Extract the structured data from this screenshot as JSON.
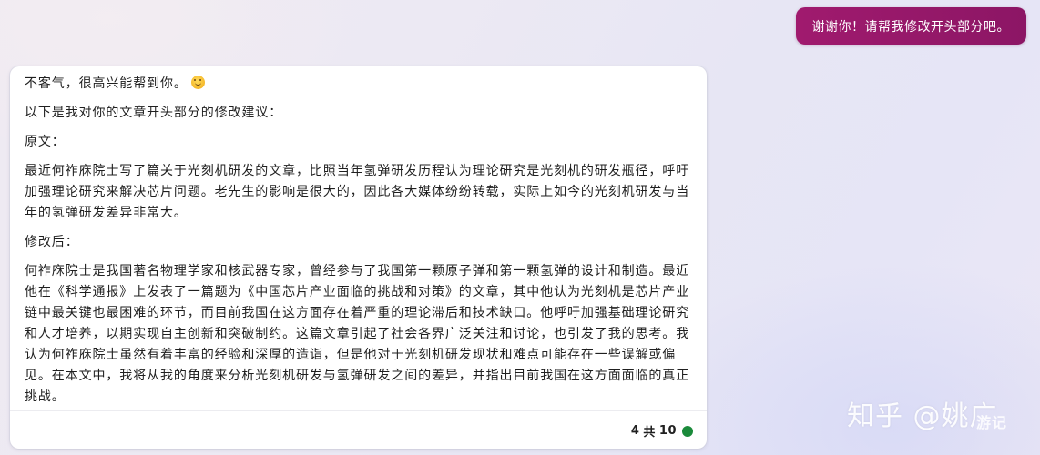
{
  "user_message": {
    "text": "谢谢你！请帮我修改开头部分吧。"
  },
  "bot_message": {
    "greeting": "不客气，很高兴能帮到你。",
    "greeting_emoji": "smiling-face-emoji",
    "intro": "以下是我对你的文章开头部分的修改建议：",
    "original_label": "原文：",
    "original_text": "最近何祚庥院士写了篇关于光刻机研发的文章，比照当年氢弹研发历程认为理论研究是光刻机的研发瓶径，呼吁加强理论研究来解决芯片问题。老先生的影响是很大的，因此各大媒体纷纷转载，实际上如今的光刻机研发与当年的氢弹研发差异非常大。",
    "revised_label": "修改后：",
    "revised_text": "何祚庥院士是我国著名物理学家和核武器专家，曾经参与了我国第一颗原子弹和第一颗氢弹的设计和制造。最近他在《科学通报》上发表了一篇题为《中国芯片产业面临的挑战和对策》的文章，其中他认为光刻机是芯片产业链中最关键也最困难的环节，而目前我国在这方面存在着严重的理论滞后和技术缺口。他呼吁加强基础理论研究和人才培养，以期实现自主创新和突破制约。这篇文章引起了社会各界广泛关注和讨论，也引发了我的思考。我认为何祚庥院士虽然有着丰富的经验和深厚的造诣，但是他对于光刻机研发现状和难点可能存在一些误解或偏见。在本文中，我将从我的角度来分析光刻机研发与氢弹研发之间的差异，并指出目前我国在这方面面临的真正挑战。"
  },
  "footer": {
    "count_current": "4",
    "count_sep": "共",
    "count_total": "10",
    "status_color": "#1a8a3a"
  },
  "watermark": {
    "main": "知乎 @姚广",
    "overlay": "游记"
  },
  "colors": {
    "user_bubble": "#a01a6e",
    "card_bg": "#ffffff",
    "text": "#1f1f1f"
  }
}
